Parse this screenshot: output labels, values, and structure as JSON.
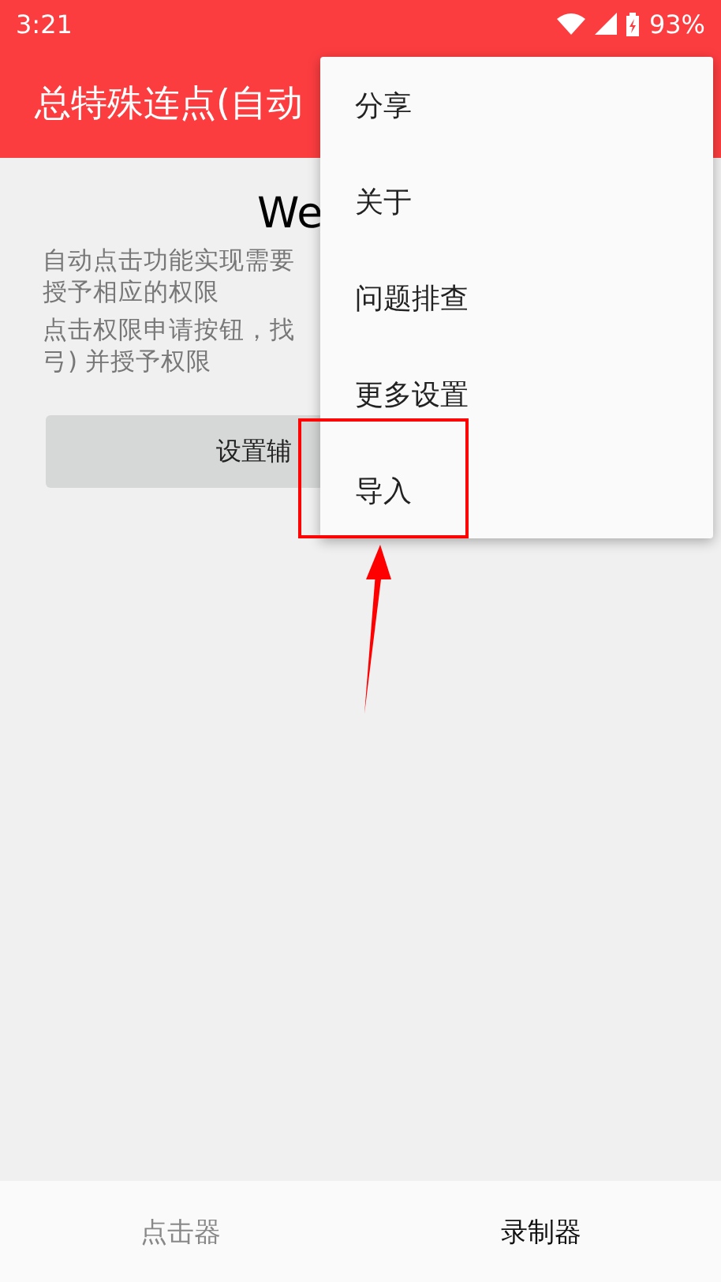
{
  "status_bar": {
    "time": "3:21",
    "battery": "93%"
  },
  "app_bar": {
    "title": "总特殊连点(自动"
  },
  "content": {
    "heading": "We",
    "paragraphs": [
      [
        "自动点击功能实现需要",
        "授予相应的权限"
      ],
      [
        "点击权限申请按钮，找",
        "弓) 并授予权限"
      ]
    ],
    "button": "设置辅"
  },
  "menu": {
    "items": [
      {
        "label": "分享"
      },
      {
        "label": "关于"
      },
      {
        "label": "问题排查"
      },
      {
        "label": "更多设置"
      },
      {
        "label": "导入"
      }
    ]
  },
  "bottom_nav": [
    {
      "label": "点击器",
      "selected": false
    },
    {
      "label": "录制器",
      "selected": true
    }
  ]
}
